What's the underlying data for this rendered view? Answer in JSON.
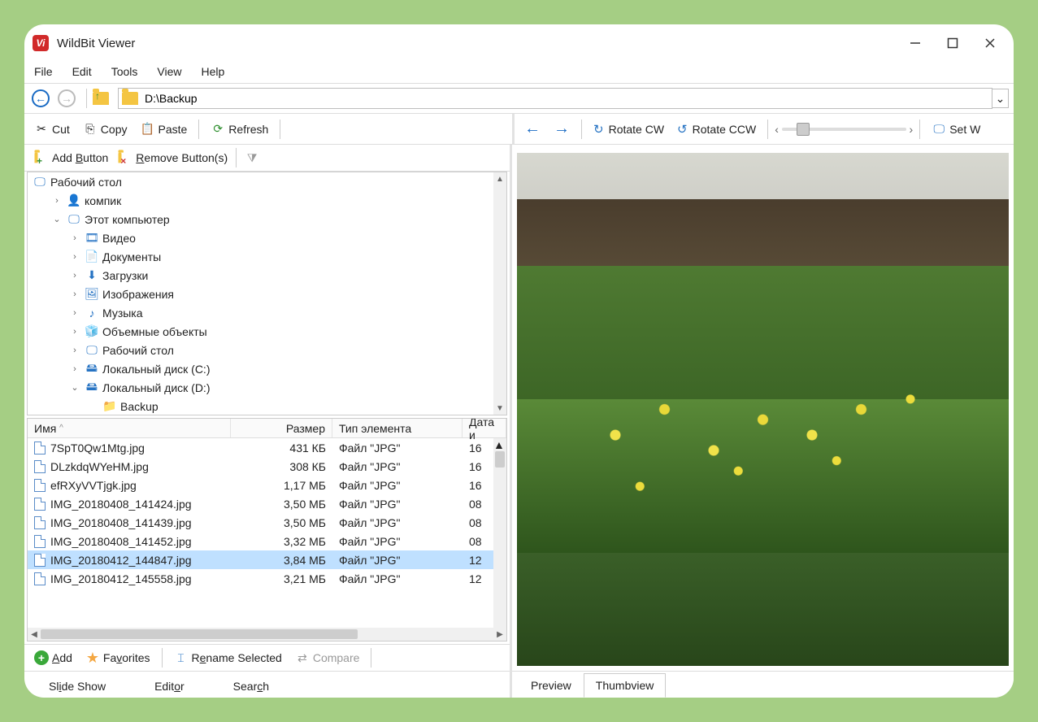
{
  "app": {
    "title": "WildBit Viewer"
  },
  "menu": {
    "file": "File",
    "edit": "Edit",
    "tools": "Tools",
    "view": "View",
    "help": "Help"
  },
  "nav": {
    "path": "D:\\Backup"
  },
  "toolbar": {
    "cut": "Cut",
    "copy": "Copy",
    "paste": "Paste",
    "refresh": "Refresh",
    "rotate_cw": "Rotate CW",
    "rotate_ccw": "Rotate CCW",
    "set_w": "Set W"
  },
  "toolbar2": {
    "add_button": "Add Button",
    "remove_buttons": "Remove Button(s)"
  },
  "tree": {
    "root": "Рабочий стол",
    "items": [
      {
        "label": "компик",
        "exp": ">",
        "indent": 1,
        "icon": "user"
      },
      {
        "label": "Этот компьютер",
        "exp": "v",
        "indent": 1,
        "icon": "monitor"
      },
      {
        "label": "Видео",
        "exp": ">",
        "indent": 2,
        "icon": "video"
      },
      {
        "label": "Документы",
        "exp": ">",
        "indent": 2,
        "icon": "doc"
      },
      {
        "label": "Загрузки",
        "exp": ">",
        "indent": 2,
        "icon": "download"
      },
      {
        "label": "Изображения",
        "exp": ">",
        "indent": 2,
        "icon": "images"
      },
      {
        "label": "Музыка",
        "exp": ">",
        "indent": 2,
        "icon": "music"
      },
      {
        "label": "Объемные объекты",
        "exp": ">",
        "indent": 2,
        "icon": "3d"
      },
      {
        "label": "Рабочий стол",
        "exp": ">",
        "indent": 2,
        "icon": "monitor"
      },
      {
        "label": "Локальный диск (C:)",
        "exp": ">",
        "indent": 2,
        "icon": "drive"
      },
      {
        "label": "Локальный диск (D:)",
        "exp": "v",
        "indent": 2,
        "icon": "drive"
      },
      {
        "label": "Backup",
        "exp": "",
        "indent": 3,
        "icon": "folder"
      }
    ]
  },
  "columns": {
    "name": "Имя",
    "size": "Размер",
    "type": "Тип элемента",
    "date": "Дата и"
  },
  "files": [
    {
      "name": "7SpT0Qw1Mtg.jpg",
      "size": "431 КБ",
      "type": "Файл \"JPG\"",
      "date": "16",
      "selected": false
    },
    {
      "name": "DLzkdqWYeHM.jpg",
      "size": "308 КБ",
      "type": "Файл \"JPG\"",
      "date": "16",
      "selected": false
    },
    {
      "name": "efRXyVVTjgk.jpg",
      "size": "1,17 МБ",
      "type": "Файл \"JPG\"",
      "date": "16",
      "selected": false
    },
    {
      "name": "IMG_20180408_141424.jpg",
      "size": "3,50 МБ",
      "type": "Файл \"JPG\"",
      "date": "08",
      "selected": false
    },
    {
      "name": "IMG_20180408_141439.jpg",
      "size": "3,50 МБ",
      "type": "Файл \"JPG\"",
      "date": "08",
      "selected": false
    },
    {
      "name": "IMG_20180408_141452.jpg",
      "size": "3,32 МБ",
      "type": "Файл \"JPG\"",
      "date": "08",
      "selected": false
    },
    {
      "name": "IMG_20180412_144847.jpg",
      "size": "3,84 МБ",
      "type": "Файл \"JPG\"",
      "date": "12",
      "selected": true
    },
    {
      "name": "IMG_20180412_145558.jpg",
      "size": "3,21 МБ",
      "type": "Файл \"JPG\"",
      "date": "12",
      "selected": false
    }
  ],
  "bottom": {
    "add": "Add",
    "favorites": "Favorites",
    "rename": "Rename Selected",
    "compare": "Compare"
  },
  "tabs_left": {
    "slideshow": "Slide Show",
    "editor": "Editor",
    "search": "Search"
  },
  "tabs_right": {
    "preview": "Preview",
    "thumbview": "Thumbview"
  }
}
